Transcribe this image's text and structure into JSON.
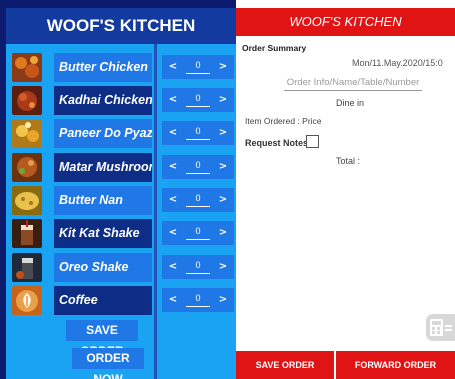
{
  "left_panel": {
    "title": "WOOF'S KITCHEN",
    "items": [
      {
        "name": "Butter Chicken",
        "qty": "0",
        "minus": "<",
        "plus": ">"
      },
      {
        "name": "Kadhai Chicken",
        "qty": "0",
        "minus": "<",
        "plus": ">"
      },
      {
        "name": "Paneer Do Pyaza",
        "qty": "0",
        "minus": "<",
        "plus": ">"
      },
      {
        "name": "Matar Mushroom",
        "qty": "0",
        "minus": "<",
        "plus": ">"
      },
      {
        "name": "Butter Nan",
        "qty": "0",
        "minus": "<",
        "plus": ">"
      },
      {
        "name": "Kit Kat Shake",
        "qty": "0",
        "minus": "<",
        "plus": ">"
      },
      {
        "name": "Oreo Shake",
        "qty": "0",
        "minus": "<",
        "plus": ">"
      },
      {
        "name": "Coffee",
        "qty": "0",
        "minus": "<",
        "plus": ">"
      }
    ],
    "save_order_label": "SAVE ORDER",
    "order_now_label": "ORDER NOW"
  },
  "right_panel": {
    "title": "WOOF'S KITCHEN",
    "order_summary_label": "Order Summary",
    "date_time": "Mon/11.May.2020/15:0",
    "order_info_placeholder": "Order Info/Name/Table/Number",
    "dine_in": "Dine in",
    "item_ordered_label": "Item Ordered : Price",
    "request_notes_label": "Request Notes",
    "total_label": "Total :",
    "save_order_label": "SAVE ORDER",
    "forward_order_label": "FORWARD ORDER"
  },
  "colors": {
    "left_dark": "#0d1b6e",
    "left_light": "#1aa3f2",
    "row_blue": "#1f78e6",
    "row_navy": "#0d2d86",
    "red": "#e01414"
  },
  "icons": {
    "calculator": "calculator-icon"
  }
}
